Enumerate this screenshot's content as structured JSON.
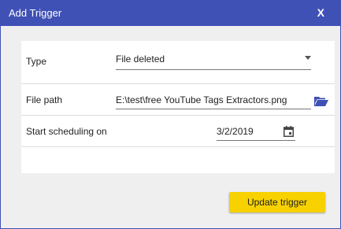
{
  "window": {
    "title": "Add Trigger",
    "close_label": "X"
  },
  "form": {
    "type": {
      "label": "Type",
      "value": "File deleted"
    },
    "file_path": {
      "label": "File path",
      "value": "E:\\test\\free YouTube Tags Extractors.png"
    },
    "start": {
      "label": "Start scheduling on",
      "value": "3/2/2019"
    }
  },
  "actions": {
    "update_label": "Update trigger"
  },
  "colors": {
    "titlebar": "#3f51b5",
    "button": "#f7d200",
    "folder_icon": "#3f51b5"
  },
  "icons": {
    "type_select": "chevron-down-icon",
    "browse": "folder-open-icon",
    "date": "calendar-icon"
  }
}
